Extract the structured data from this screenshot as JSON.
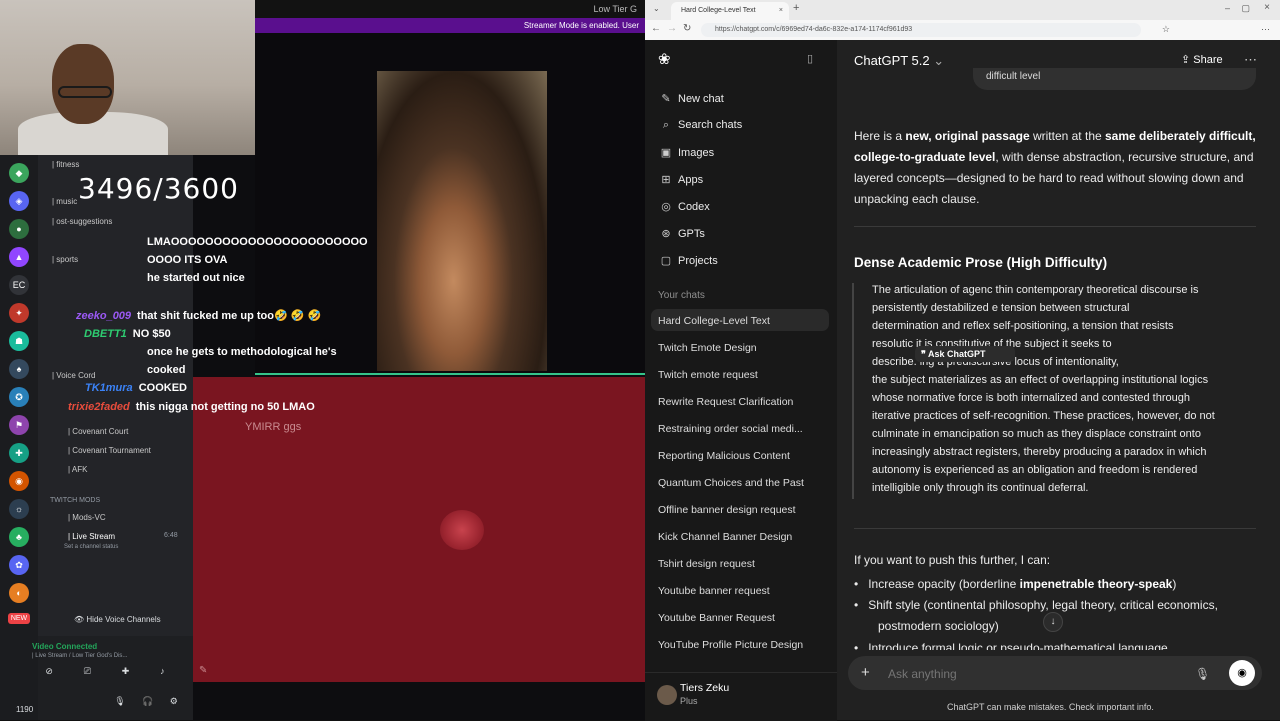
{
  "stream": {
    "topbar_text": "Low Tier G",
    "streamer_mode": "Streamer Mode is enabled. User",
    "viewer_count": "3496/3600",
    "yaml_caption": "YMIRR ggs"
  },
  "discord": {
    "channels": [
      {
        "name": "| fitness"
      },
      {
        "name": "| music"
      },
      {
        "name": "| ost-suggestions"
      },
      {
        "name": "| sports"
      },
      {
        "name": "| Voice Cord"
      },
      {
        "name": "| Covenant Court"
      },
      {
        "name": "| Covenant Tournament"
      },
      {
        "name": "| AFK"
      },
      {
        "name": "TWITCH MODS"
      },
      {
        "name": "| Mods-VC"
      },
      {
        "name": "| Live Stream"
      },
      {
        "name": "Set a channel status"
      }
    ],
    "live_stream_time": "6:48",
    "hide_voice": "Hide Voice Channels",
    "voice_connected": "Video Connected",
    "voice_sub": "| Live Stream / Low Tier God's Dis...",
    "user_count": "1190",
    "rail_badge": "EC",
    "new_badge": "NEW"
  },
  "chat": [
    {
      "user": "",
      "msg": "LMAOOOOOOOOOOOOOOOOOOOOOOO",
      "color": "#ffffff"
    },
    {
      "user": "",
      "msg": "OOOO ITS OVA",
      "color": "#ffffff"
    },
    {
      "user": "",
      "msg": "he started out nice",
      "color": "#ffffff"
    },
    {
      "user": "zeeko_009",
      "msg": "that shit fucked me up too🤣 🤣 🤣",
      "color": "#9b59f5"
    },
    {
      "user": "DBETT1",
      "msg": "NO $50",
      "color": "#2ecc71"
    },
    {
      "user": "",
      "msg": "once he gets to methodological he's",
      "color": "#ffffff"
    },
    {
      "user": "",
      "msg": "cooked",
      "color": "#ffffff"
    },
    {
      "user": "TK1mura",
      "msg": "COOKED",
      "color": "#3b82f6"
    },
    {
      "user": "trixie2faded",
      "msg": "this nigga not getting no 50 LMAO",
      "color": "#e74c3c"
    }
  ],
  "browser": {
    "tab_title": "Hard College-Level Text",
    "url": "https://chatgpt.com/c/6969ed74-da6c-832e-a174-1174cf961d93"
  },
  "chatgpt": {
    "model": "ChatGPT 5.2",
    "share": "Share",
    "nav": [
      "New chat",
      "Search chats",
      "Images",
      "Apps",
      "Codex",
      "GPTs",
      "Projects"
    ],
    "nav_icons": [
      "✎",
      "⌕",
      "▣",
      "⊞",
      "◎",
      "⊛",
      "▢"
    ],
    "your_chats": "Your chats",
    "history": [
      "Hard College-Level Text",
      "Twitch Emote Design",
      "Twitch emote request",
      "Rewrite Request Clarification",
      "Restraining order social medi...",
      "Reporting Malicious Content",
      "Quantum Choices and the Past",
      "Offline banner design request",
      "Kick Channel Banner Design",
      "Tshirt design request",
      "Youtube banner request",
      "Youtube Banner Request",
      "YouTube Profile Picture Design"
    ],
    "user": {
      "name": "Tiers Zeku",
      "plan": "Plus"
    },
    "prev_bubble": "difficult level",
    "intro": {
      "a": "Here is a ",
      "b": "new, original passage",
      "c": " written at the ",
      "d": "same deliberately difficult,",
      "e": "college-to-graduate level",
      "f": ", with dense abstraction, recursive structure, and",
      "g": "layered concepts—designed to be hard to read without slowing down and",
      "h": "unpacking each clause."
    },
    "heading": "Dense Academic Prose (High Difficulty)",
    "passage": [
      "The articulation of agenc     thin contemporary theoretical discourse is",
      "persistently destabilized      e tension between structural",
      "determination and reflex     self-positioning, a tension that resists",
      "resolutic                       it is constitutive of the subject it seeks to",
      "describe.                       ing a prediscursive locus of intentionality,",
      "the subject materializes as an effect of overlapping institutional logics",
      "whose normative force is both internalized and contested through",
      "iterative practices of self-recognition. These practices, however, do not",
      "culminate in emancipation so much as they displace constraint onto",
      "increasingly abstract registers, thereby producing a paradox in which",
      "autonomy is experienced as an obligation and freedom is rendered",
      "intelligible only through its continual deferral."
    ],
    "ask_popup": "Ask ChatGPT",
    "followup": "If you want to push this further, I can:",
    "bullets": [
      {
        "pre": "Increase opacity (borderline ",
        "bold": "impenetrable theory-speak",
        "post": ")"
      },
      {
        "pre": "Shift style (continental philosophy, legal theory, critical economics,",
        "bold": "",
        "post": ""
      },
      {
        "pre": "postmodern sociology)",
        "bold": "",
        "post": ""
      },
      {
        "pre": "Introduce formal logic or pseudo-mathematical language",
        "bold": "",
        "post": ""
      }
    ],
    "composer_placeholder": "Ask anything",
    "disclaimer": "ChatGPT can make mistakes. Check important info."
  }
}
